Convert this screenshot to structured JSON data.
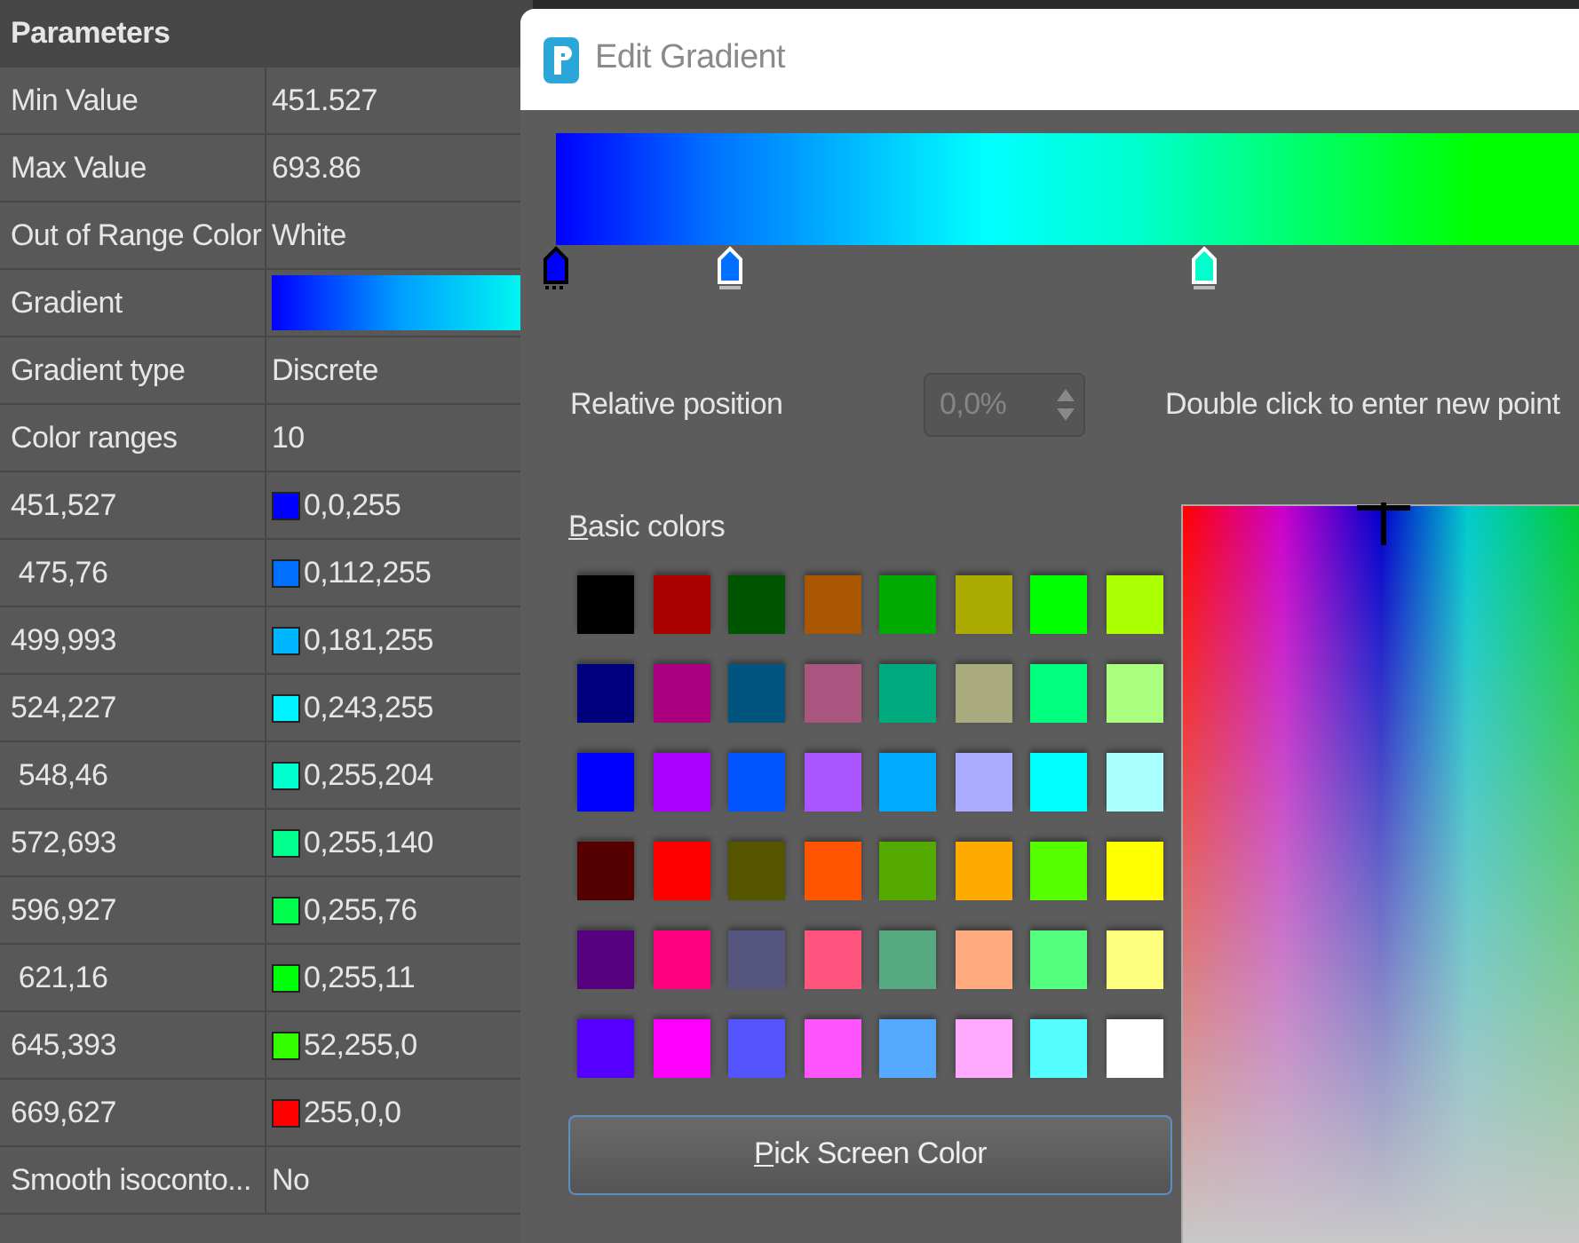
{
  "panel": {
    "title": "Parameters",
    "rows": [
      {
        "kind": "text",
        "label": "Min Value",
        "value": "451.527"
      },
      {
        "kind": "text",
        "label": "Max Value",
        "value": "693.86"
      },
      {
        "kind": "text",
        "label": "Out of Range Color",
        "value": "White"
      },
      {
        "kind": "gradient",
        "label": "Gradient"
      },
      {
        "kind": "text",
        "label": "Gradient type",
        "value": "Discrete"
      },
      {
        "kind": "text",
        "label": "Color ranges",
        "value": "10"
      },
      {
        "kind": "color",
        "label": "451,527",
        "value": "0,0,255",
        "color": "#0000ff"
      },
      {
        "kind": "color",
        "label": " 475,76",
        "value": "0,112,255",
        "color": "#0070ff"
      },
      {
        "kind": "color",
        "label": "499,993",
        "value": "0,181,255",
        "color": "#00b5ff"
      },
      {
        "kind": "color",
        "label": "524,227",
        "value": "0,243,255",
        "color": "#00f3ff"
      },
      {
        "kind": "color",
        "label": " 548,46",
        "value": "0,255,204",
        "color": "#00ffcc"
      },
      {
        "kind": "color",
        "label": "572,693",
        "value": "0,255,140",
        "color": "#00ff8c"
      },
      {
        "kind": "color",
        "label": "596,927",
        "value": "0,255,76",
        "color": "#00ff4c"
      },
      {
        "kind": "color",
        "label": " 621,16",
        "value": "0,255,11",
        "color": "#00ff0b"
      },
      {
        "kind": "color",
        "label": "645,393",
        "value": "52,255,0",
        "color": "#34ff00"
      },
      {
        "kind": "color",
        "label": "669,627",
        "value": "255,0,0",
        "color": "#ff0000"
      },
      {
        "kind": "text",
        "label": "Smooth isoconto...",
        "value": "No"
      }
    ]
  },
  "dialog": {
    "title": "Edit Gradient",
    "gradient_stops": [
      {
        "color": "#0000ff",
        "level": 0,
        "selected": true
      },
      {
        "color": "#0070ff",
        "level": 0.17,
        "selected": false
      },
      {
        "color": "#00ffcc",
        "level": 0.634,
        "selected": false
      }
    ],
    "relative_position": {
      "label": "Relative position",
      "value": "0,0%",
      "disabled": true
    },
    "hint": "Double click to enter new point",
    "basic_colors": {
      "label": "Basic colors",
      "swatches": [
        {
          "color": "#000000"
        },
        {
          "color": "#aa0000"
        },
        {
          "color": "#005500"
        },
        {
          "color": "#aa5500"
        },
        {
          "color": "#00aa00"
        },
        {
          "color": "#aaaa00"
        },
        {
          "color": "#00ff00"
        },
        {
          "color": "#aaff00"
        },
        {
          "color": "#00007f"
        },
        {
          "color": "#aa007f"
        },
        {
          "color": "#00557f"
        },
        {
          "color": "#aa557f"
        },
        {
          "color": "#00aa7f"
        },
        {
          "color": "#aaaa7f"
        },
        {
          "color": "#00ff7f"
        },
        {
          "color": "#aaff7f"
        },
        {
          "color": "#0000ff"
        },
        {
          "color": "#aa00ff"
        },
        {
          "color": "#0055ff"
        },
        {
          "color": "#aa55ff"
        },
        {
          "color": "#00aaff"
        },
        {
          "color": "#aaaaff"
        },
        {
          "color": "#00ffff"
        },
        {
          "color": "#aaffff"
        },
        {
          "color": "#550000"
        },
        {
          "color": "#ff0000"
        },
        {
          "color": "#555500"
        },
        {
          "color": "#ff5500"
        },
        {
          "color": "#55aa00"
        },
        {
          "color": "#ffaa00"
        },
        {
          "color": "#55ff00"
        },
        {
          "color": "#ffff00"
        },
        {
          "color": "#55007f"
        },
        {
          "color": "#ff007f"
        },
        {
          "color": "#55557f"
        },
        {
          "color": "#ff557f"
        },
        {
          "color": "#55aa7f"
        },
        {
          "color": "#ffaa7f"
        },
        {
          "color": "#55ff7f"
        },
        {
          "color": "#ffff7f"
        },
        {
          "color": "#5500ff"
        },
        {
          "color": "#ff00ff"
        },
        {
          "color": "#5555ff"
        },
        {
          "color": "#ff55ff"
        },
        {
          "color": "#55aaff"
        },
        {
          "color": "#ffaaff"
        },
        {
          "color": "#55ffff"
        },
        {
          "color": "#ffffff"
        }
      ]
    },
    "pick_button": "Pick Screen Color"
  }
}
